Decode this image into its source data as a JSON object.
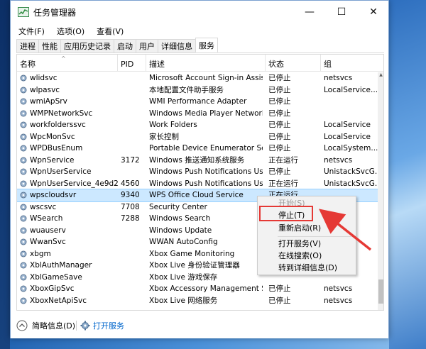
{
  "window": {
    "title": "任务管理器",
    "minimize_glyph": "—",
    "maximize_glyph": "☐",
    "close_glyph": "✕"
  },
  "menu": [
    "文件(F)",
    "选项(O)",
    "查看(V)"
  ],
  "tabs": [
    "进程",
    "性能",
    "应用历史记录",
    "启动",
    "用户",
    "详细信息",
    "服务"
  ],
  "active_tab": "服务",
  "columns": {
    "name": "名称",
    "pid": "PID",
    "desc": "描述",
    "status": "状态",
    "group": "组"
  },
  "rows": [
    {
      "name": "wlidsvc",
      "pid": "",
      "desc": "Microsoft Account Sign-in Assist",
      "status": "已停止",
      "group": "netsvcs"
    },
    {
      "name": "wlpasvc",
      "pid": "",
      "desc": "本地配置文件助手服务",
      "status": "已停止",
      "group": "LocalService..."
    },
    {
      "name": "wmiApSrv",
      "pid": "",
      "desc": "WMI Performance Adapter",
      "status": "已停止",
      "group": ""
    },
    {
      "name": "WMPNetworkSvc",
      "pid": "",
      "desc": "Windows Media Player Network ...",
      "status": "已停止",
      "group": ""
    },
    {
      "name": "workfolderssvc",
      "pid": "",
      "desc": "Work Folders",
      "status": "已停止",
      "group": "LocalService"
    },
    {
      "name": "WpcMonSvc",
      "pid": "",
      "desc": "家长控制",
      "status": "已停止",
      "group": "LocalService"
    },
    {
      "name": "WPDBusEnum",
      "pid": "",
      "desc": "Portable Device Enumerator Serv",
      "status": "已停止",
      "group": "LocalSystem..."
    },
    {
      "name": "WpnService",
      "pid": "3172",
      "desc": "Windows 推送通知系统服务",
      "status": "正在运行",
      "group": "netsvcs"
    },
    {
      "name": "WpnUserService",
      "pid": "",
      "desc": "Windows Push Notifications User...",
      "status": "已停止",
      "group": "UnistackSvcG..."
    },
    {
      "name": "WpnUserService_4e9d2",
      "pid": "4560",
      "desc": "Windows Push Notifications User...",
      "status": "正在运行",
      "group": "UnistackSvcG..."
    },
    {
      "name": "wpscloudsvr",
      "pid": "9340",
      "desc": "WPS Office Cloud Service",
      "status": "正在运行",
      "group": ""
    },
    {
      "name": "wscsvc",
      "pid": "7708",
      "desc": "Security Center",
      "status": "",
      "group": "...vice..."
    },
    {
      "name": "WSearch",
      "pid": "7288",
      "desc": "Windows Search",
      "status": "",
      "group": ""
    },
    {
      "name": "wuauserv",
      "pid": "",
      "desc": "Windows Update",
      "status": "",
      "group": ""
    },
    {
      "name": "WwanSvc",
      "pid": "",
      "desc": "WWAN AutoConfig",
      "status": "",
      "group": "...e"
    },
    {
      "name": "xbgm",
      "pid": "",
      "desc": "Xbox Game Monitoring",
      "status": "",
      "group": ""
    },
    {
      "name": "XblAuthManager",
      "pid": "",
      "desc": "Xbox Live 身份验证管理器",
      "status": "",
      "group": ""
    },
    {
      "name": "XblGameSave",
      "pid": "",
      "desc": "Xbox Live 游戏保存",
      "status": "",
      "group": ""
    },
    {
      "name": "XboxGipSvc",
      "pid": "",
      "desc": "Xbox Accessory Management Se...",
      "status": "已停止",
      "group": "netsvcs"
    },
    {
      "name": "XboxNetApiSvc",
      "pid": "",
      "desc": "Xbox Live 网络服务",
      "status": "已停止",
      "group": "netsvcs"
    }
  ],
  "selected_row": "wpscloudsvr",
  "context_menu": {
    "start": "开始(S)",
    "stop": "停止(T)",
    "restart": "重新启动(R)",
    "open_services": "打开服务(V)",
    "search_online": "在线搜索(O)",
    "go_to_details": "转到详细信息(D)"
  },
  "footer": {
    "fewer_details": "简略信息(D)",
    "open_services": "打开服务"
  },
  "colors": {
    "selection": "#cce8ff",
    "highlight_red": "#e53935",
    "link_blue": "#0066cc"
  }
}
